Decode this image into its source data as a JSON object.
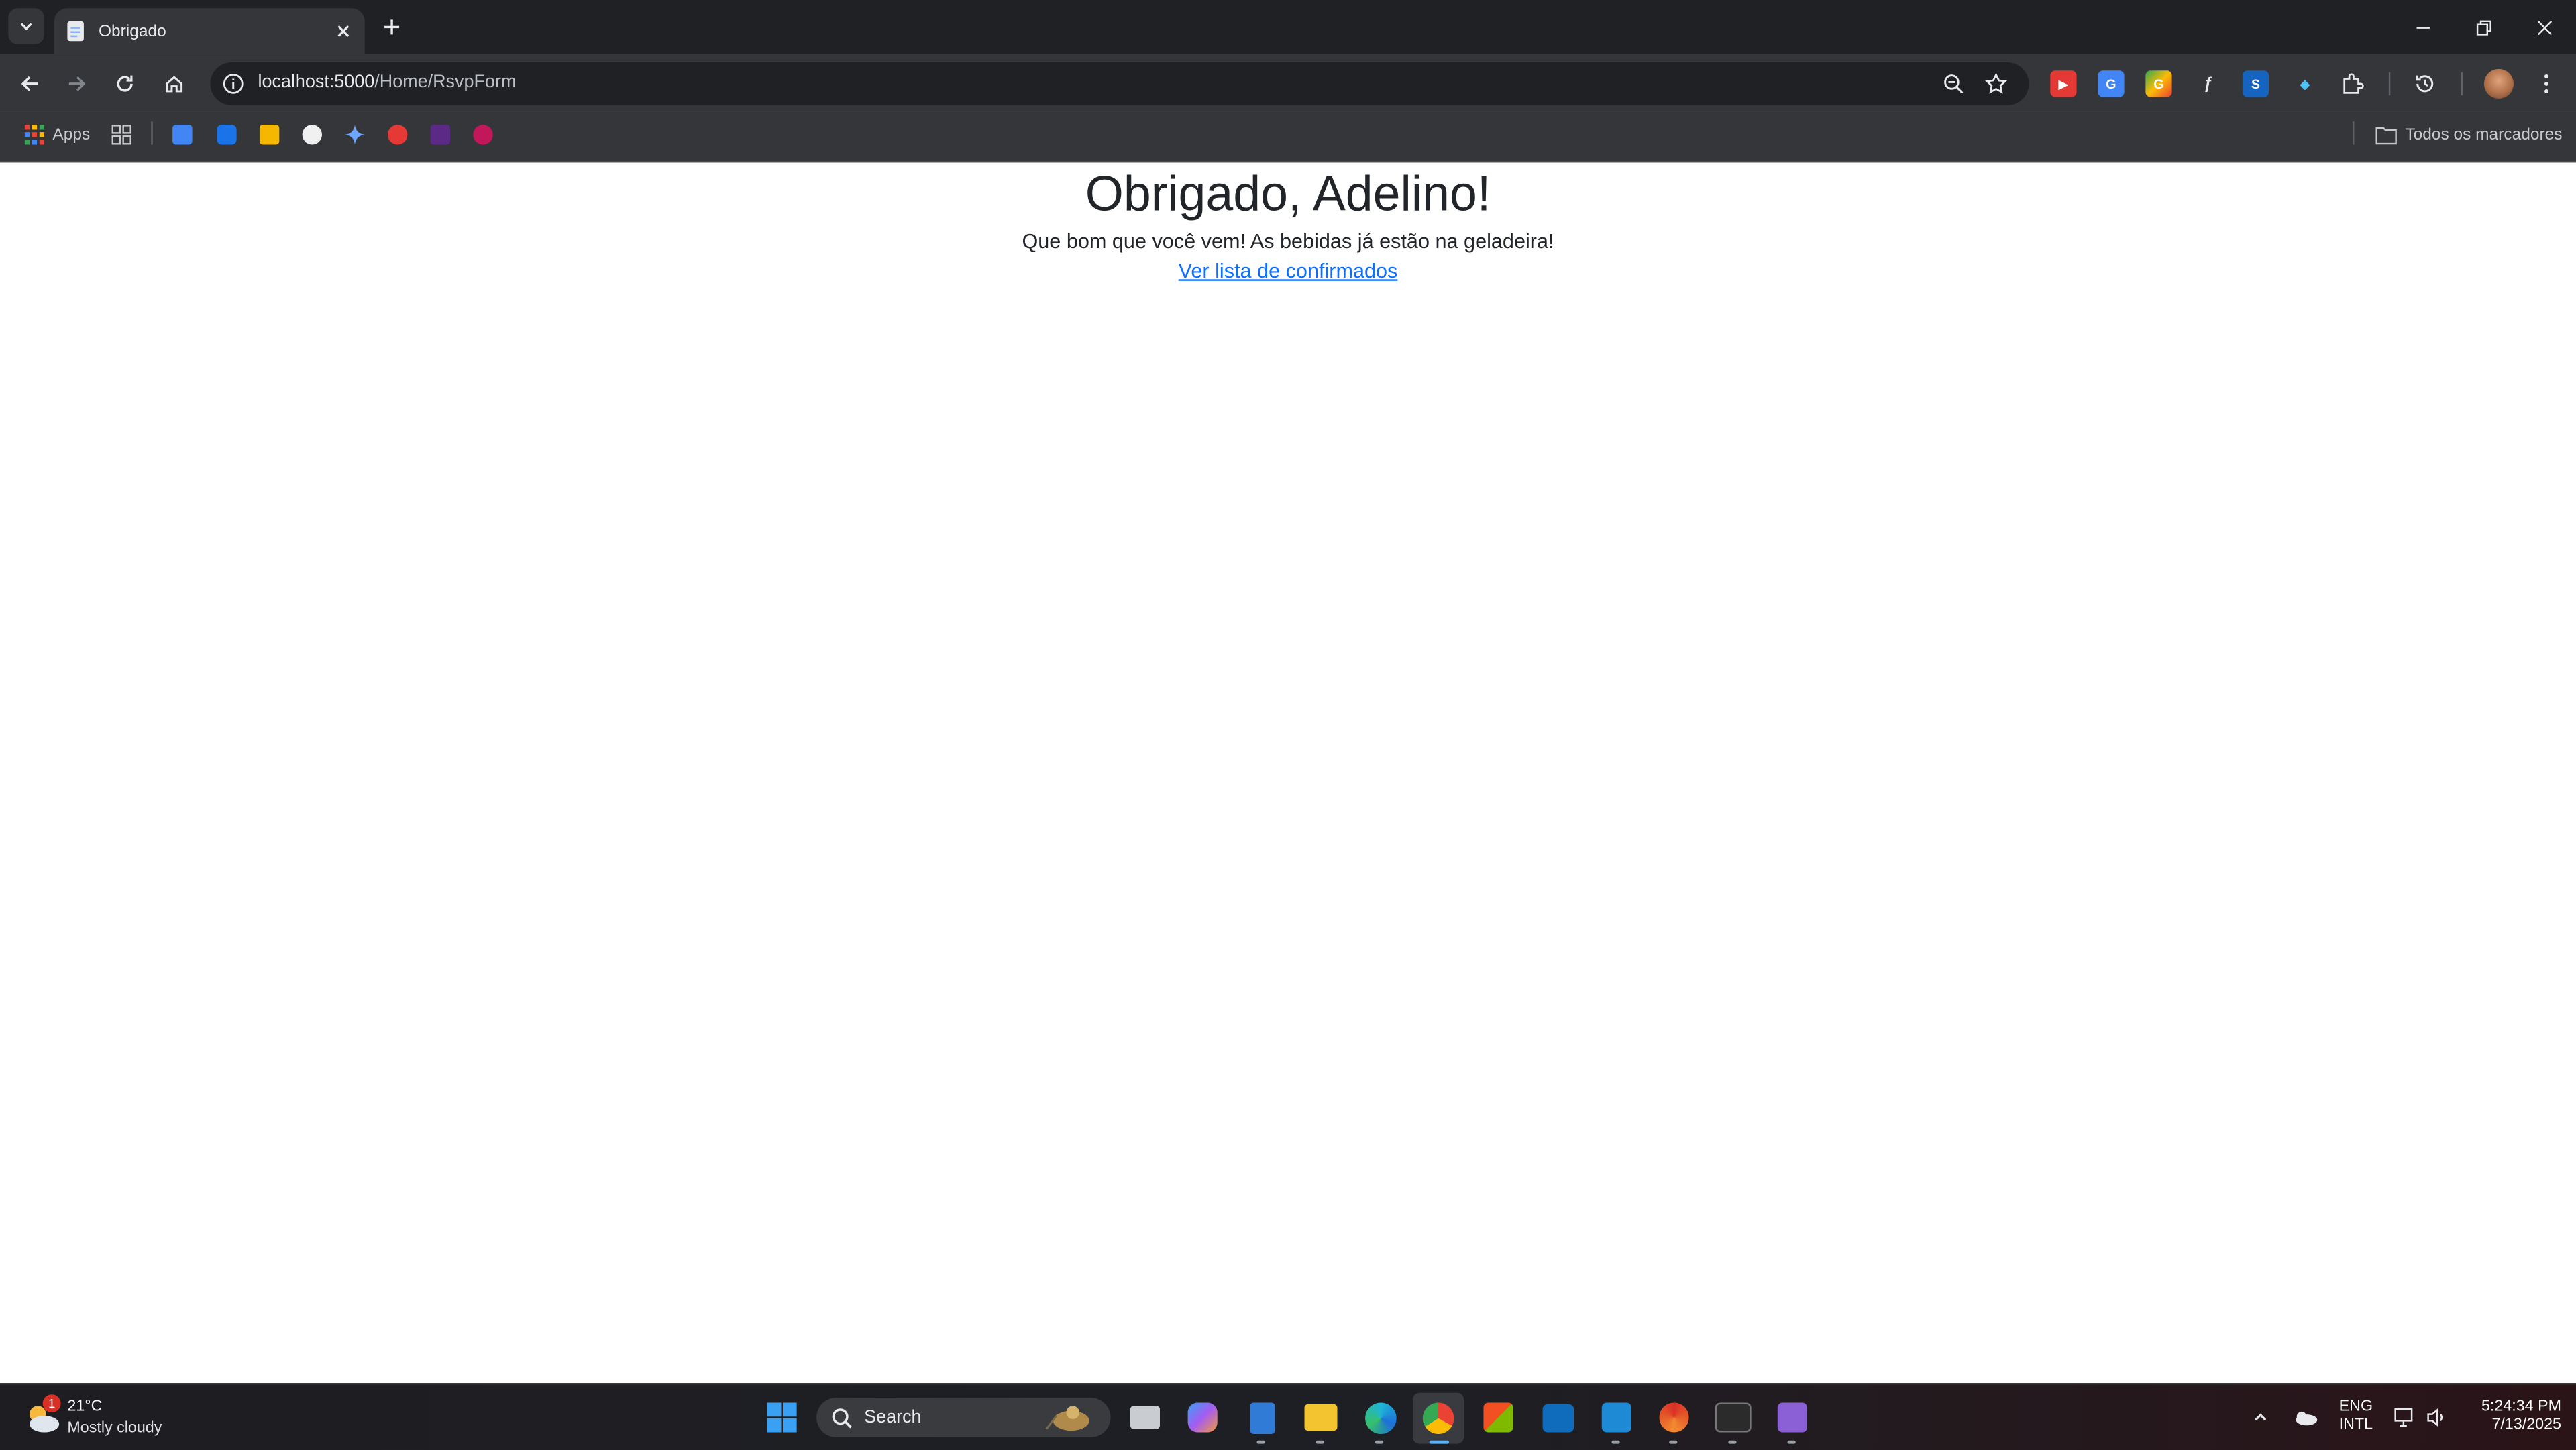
{
  "browser": {
    "tab": {
      "title": "Obrigado"
    },
    "address": {
      "host": "localhost:5000",
      "path": "/Home/RsvpForm"
    },
    "bookmarks": {
      "apps_label": "Apps",
      "all_bookmarks_label": "Todos os marcadores"
    }
  },
  "page": {
    "heading": "Obrigado, Adelino!",
    "message": "Que bom que você vem! As bebidas já estão na geladeira!",
    "link": "Ver lista de confirmados"
  },
  "taskbar": {
    "weather": {
      "temp": "21°C",
      "desc": "Mostly cloudy",
      "badge": "1"
    },
    "search_label": "Search",
    "language": {
      "lang": "ENG",
      "layout": "INTL"
    },
    "clock": {
      "time": "5:24:34 PM",
      "date": "7/13/2025"
    }
  },
  "colors": {
    "link": "#0d6efd",
    "browser_dark": "#202124",
    "toolbar": "#35363a"
  }
}
